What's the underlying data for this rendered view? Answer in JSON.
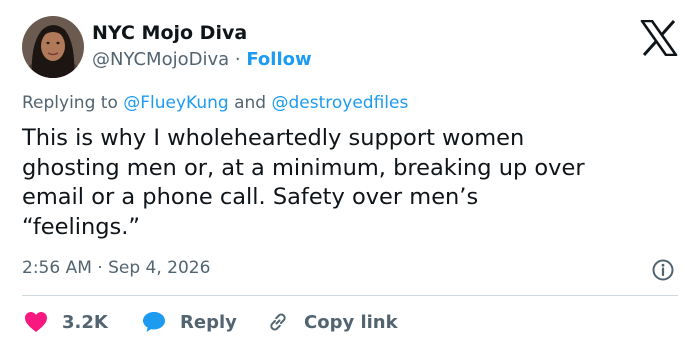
{
  "author": {
    "display_name": "NYC Mojo Diva",
    "handle": "@NYCMojoDiva",
    "separator": "·",
    "follow_label": "Follow"
  },
  "reply_context": {
    "prefix": "Replying to",
    "mention_1": "@FlueyKung",
    "conjunction": "and",
    "mention_2": "@destroyedfiles"
  },
  "tweet": {
    "line_1": "This is why I wholeheartedly support women",
    "line_2": "ghosting men or, at a minimum, breaking up over",
    "line_3": "email or a phone call. Safety over men’s",
    "line_4": "“feelings.”",
    "timestamp": "2:56 AM · Sep 4, 2026"
  },
  "actions": {
    "like_count": "3.2K",
    "reply_label": "Reply",
    "copy_label": "Copy link"
  },
  "icons": {
    "brand": "x-logo-icon",
    "info": "info-icon",
    "like": "heart-icon",
    "reply": "speech-bubble-icon",
    "copy": "link-icon"
  },
  "colors": {
    "accent": "#1d9bf0",
    "like": "#f91880",
    "text_primary": "#0f1419",
    "text_secondary": "#536471",
    "divider": "#cfd9de"
  }
}
